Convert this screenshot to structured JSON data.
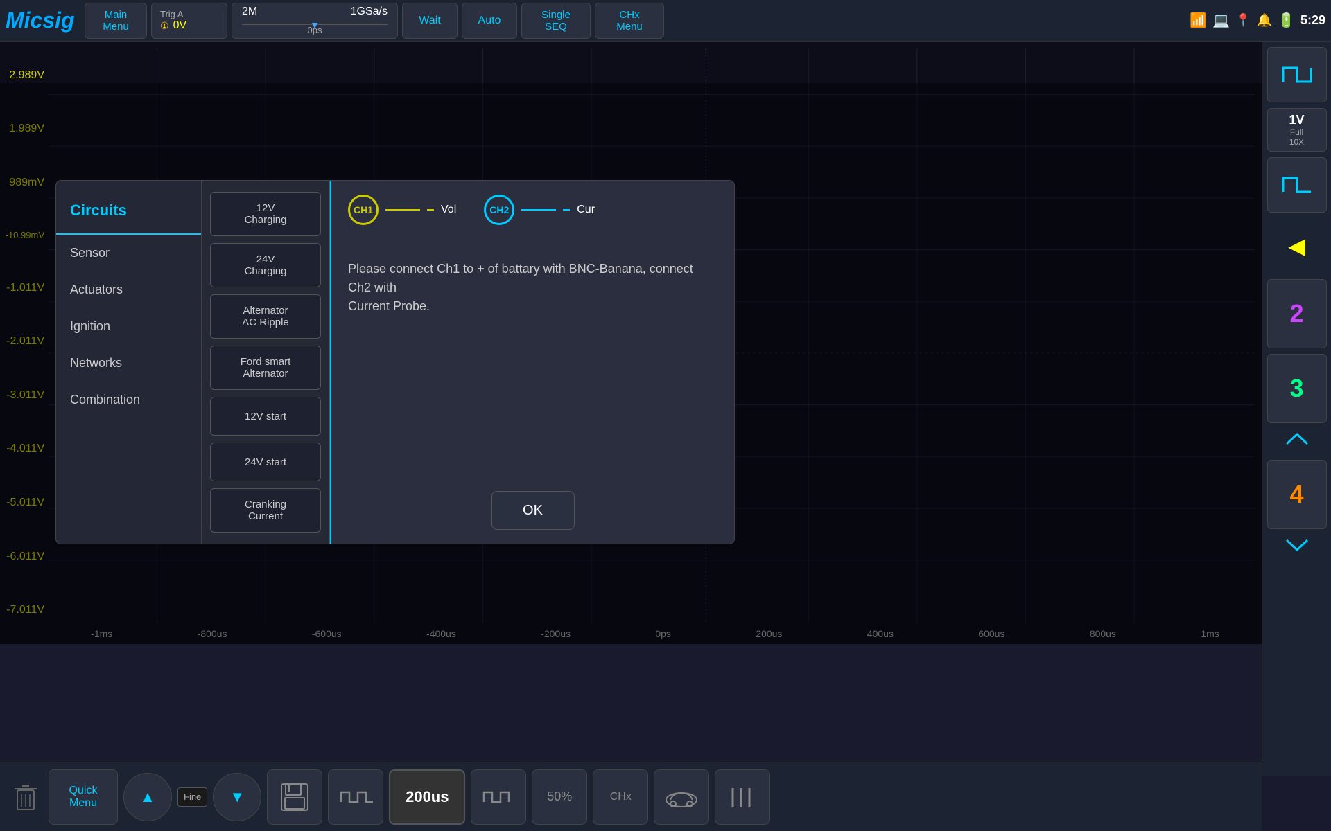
{
  "app": {
    "logo": "Micsig",
    "time_display": "5:29"
  },
  "topbar": {
    "main_menu": "Main\nMenu",
    "trig_label": "Trig A",
    "trig_dot": "①",
    "trig_value": "0V",
    "time_scale": "2M",
    "sample_rate": "1GSa/s",
    "time_offset": "0ps",
    "wait_label": "Wait",
    "auto_label": "Auto",
    "single_seq_label": "Single\nSEQ",
    "chx_menu_label": "CHx\nMenu"
  },
  "right_panel": {
    "volt_value": "1V",
    "volt_full": "Full",
    "volt_zoom": "10X",
    "ch2_label": "2",
    "ch3_label": "3",
    "ch4_label": "4"
  },
  "y_axis": {
    "labels": [
      "2.989V",
      "1.989V",
      "989mV",
      "-10.99mV",
      "-1.011V",
      "-2.011V",
      "-3.011V",
      "-4.011V",
      "-5.011V",
      "-6.011V",
      "-7.011V"
    ]
  },
  "x_axis": {
    "labels": [
      "-1ms",
      "-800us",
      "-600us",
      "-400us",
      "-200us",
      "0ps",
      "200us",
      "400us",
      "600us",
      "800us",
      "1ms"
    ]
  },
  "bottom_bar": {
    "quick_menu": "Quick\nMenu",
    "up_icon": "▲",
    "fine_label": "Fine",
    "down_icon": "▼",
    "save_icon": "💾",
    "waveform1_icon": "⊓⊓",
    "time_value": "200us",
    "waveform2_icon": "⊓⊓",
    "percent_label": "50%",
    "chx_label": "CHx",
    "car_icon": "🚗",
    "measure_icon": "|||"
  },
  "modal": {
    "sidebar_title": "Circuits",
    "sidebar_items": [
      "Sensor",
      "Actuators",
      "Ignition",
      "Networks",
      "Combination"
    ],
    "circuit_buttons": [
      {
        "label": "12V\nCharging",
        "selected": false
      },
      {
        "label": "24V\nCharging",
        "selected": false
      },
      {
        "label": "Alternator\nAC Ripple",
        "selected": false
      },
      {
        "label": "Ford smart\nAlternator",
        "selected": false
      },
      {
        "label": "12V start",
        "selected": false
      },
      {
        "label": "24V start",
        "selected": false
      },
      {
        "label": "Cranking\nCurrent",
        "selected": false
      }
    ],
    "ch1_label": "CH1",
    "ch1_channel": "Vol",
    "ch2_label": "CH2",
    "ch2_channel": "Cur",
    "instruction": "Please connect Ch1 to + of battary with BNC-Banana, connect Ch2 with\nCurrent Probe.",
    "ok_label": "OK"
  },
  "icons": {
    "wifi": "📶",
    "battery": "🔋",
    "location": "📍",
    "bell": "🔔",
    "pulse_icon": "⊓",
    "square_wave": "⊓⊓"
  }
}
